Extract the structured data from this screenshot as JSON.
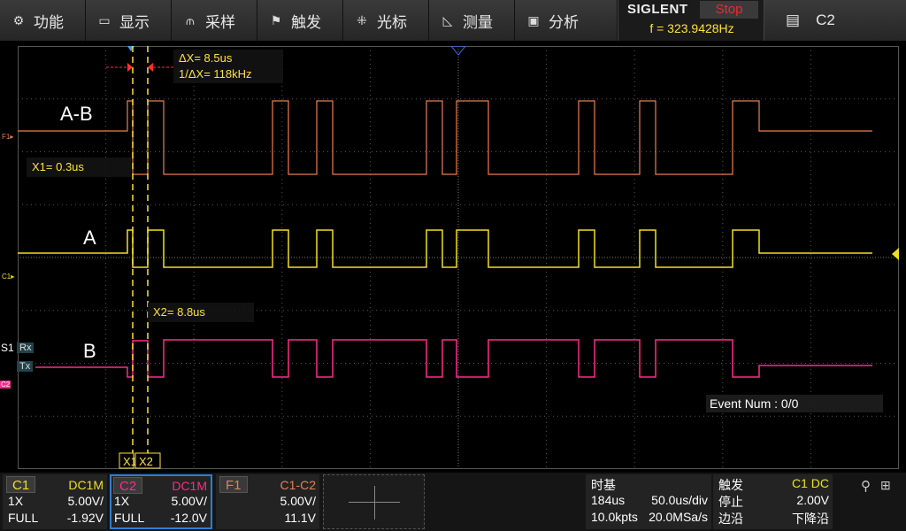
{
  "menu": [
    {
      "icon": "settings-icon",
      "glyph": "⚙",
      "label": "功能"
    },
    {
      "icon": "display-icon",
      "glyph": "▭",
      "label": "显示"
    },
    {
      "icon": "acquire-icon",
      "glyph": "⫙",
      "label": "采样"
    },
    {
      "icon": "trigger-flag-icon",
      "glyph": "⚑",
      "label": "触发"
    },
    {
      "icon": "cursor-grid-icon",
      "glyph": "⁜",
      "label": "光标"
    },
    {
      "icon": "measure-icon",
      "glyph": "◺",
      "label": "测量"
    },
    {
      "icon": "analysis-icon",
      "glyph": "▣",
      "label": "分析"
    }
  ],
  "brand": "SIGLENT",
  "run_state": "Stop",
  "frequency": "f = 323.9428Hz",
  "channel_select": {
    "icon": "channel-icon",
    "glyph": "▤",
    "label": "C2"
  },
  "cursor": {
    "delta_x": "ΔX= 8.5us",
    "inv_delta_x": "1/ΔX= 118kHz",
    "x1": "X1= 0.3us",
    "x2": "X2= 8.8us",
    "x1_tag": "X1",
    "x2_tag": "X2"
  },
  "traces": {
    "ab_label": "A-B",
    "a_label": "A",
    "b_label": "B",
    "f1_marker": "F1",
    "c1_marker": "C1",
    "c2_marker": "C2",
    "serial_label": "S1",
    "rx_label": "Rx",
    "tx_label": "Tx"
  },
  "event_num": "Event Num : 0/0",
  "colors": {
    "c1": "#f0e020",
    "c2": "#ff2a8a",
    "f1": "#e88050",
    "cursor": "#ffe23a"
  },
  "status": {
    "c1": {
      "name": "C1",
      "coupling": "DC1M",
      "probe": "1X",
      "scale": "5.00V/",
      "bw": "FULL",
      "offset": "-1.92V"
    },
    "c2": {
      "name": "C2",
      "coupling": "DC1M",
      "probe": "1X",
      "scale": "5.00V/",
      "bw": "FULL",
      "offset": "-12.0V"
    },
    "f1": {
      "name": "F1",
      "expr": "C1-C2",
      "scale": "5.00V/",
      "offset": "11.1V"
    },
    "timebase": {
      "title": "时基",
      "delay": "184us",
      "scale": "50.0us/div",
      "points": "10.0kpts",
      "rate": "20.0MSa/s"
    },
    "trigger": {
      "title": "触发",
      "source": "C1 DC",
      "state": "停止",
      "level": "2.00V",
      "type": "边沿",
      "slope": "下降沿"
    }
  }
}
